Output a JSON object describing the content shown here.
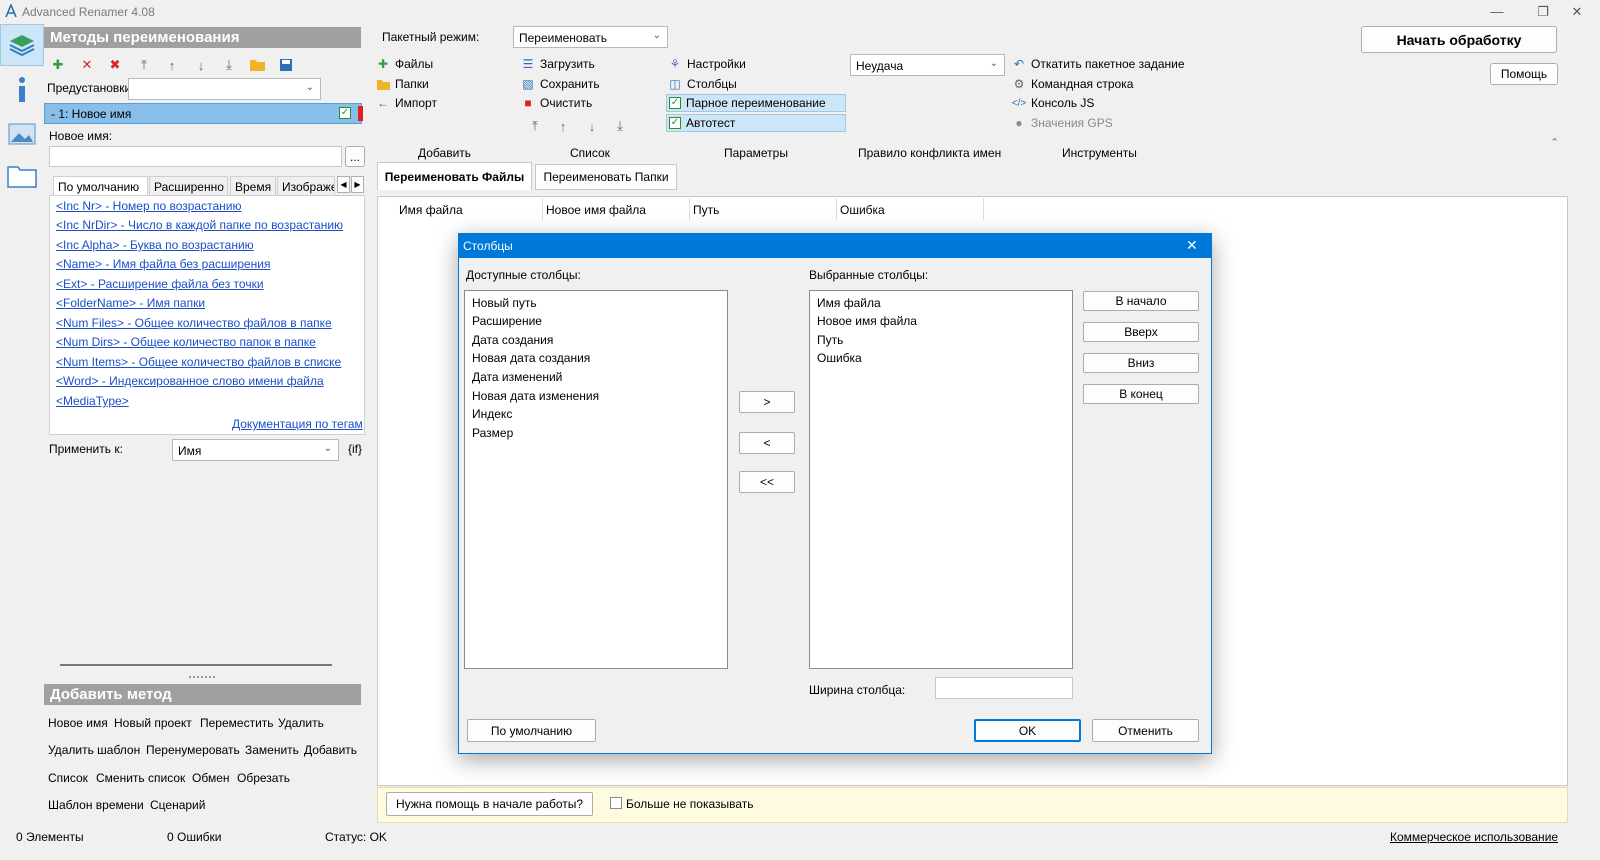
{
  "window": {
    "title": "Advanced Renamer 4.08",
    "minimize_icon": "minimize-icon",
    "restore_icon": "restore-icon",
    "close_icon": "close-icon"
  },
  "side_strip": {
    "items": [
      {
        "icon": "layers-icon",
        "active": true
      },
      {
        "icon": "info-icon",
        "active": false
      },
      {
        "icon": "image-icon",
        "active": false
      },
      {
        "icon": "folder-icon",
        "active": false
      }
    ]
  },
  "left_panel": {
    "title": "Методы переименования",
    "toolbar_icons": [
      "add-icon",
      "delete-icon",
      "clear-icon",
      "move-top-icon",
      "move-up-icon",
      "move-down-icon",
      "move-bottom-icon",
      "open-folder-icon",
      "save-icon"
    ],
    "presets_label": "Предустановки",
    "presets_value": "",
    "method_row_label": "-  1: Новое имя",
    "new_name_label": "Новое имя:",
    "new_name_value": "",
    "ellipsis_button": "...",
    "tabs": [
      "По умолчанию",
      "Расширенно",
      "Время",
      "Изображе"
    ],
    "tags": [
      "<Inc Nr> - Номер по возрастанию",
      "<Inc NrDir> - Число в каждой папке по возрастанию",
      "<Inc Alpha> - Буква по возрастанию",
      "<Name> - Имя файла без расширения",
      "<Ext> - Расширение файла без точки",
      "<FolderName> - Имя папки",
      "<Num Files> - Общее количество файлов в папке",
      "<Num Dirs> - Общее количество папок в папке",
      "<Num Items> - Общее количество файлов в списке",
      "<Word> - Индексированное слово имени файла",
      "<MediaType>"
    ],
    "docs_link": "Документация по тегам",
    "apply_to_label": "Применить к:",
    "apply_to_value": "Имя",
    "if_label": "{if}",
    "add_method_title": "Добавить метод",
    "methods": [
      [
        "Новое имя",
        "Новый проект",
        "Переместить",
        "Удалить"
      ],
      [
        "Удалить шаблон",
        "Перенумеровать",
        "Заменить",
        "Добавить"
      ],
      [
        "Список",
        "Сменить список",
        "Обмен",
        "Обрезать"
      ],
      [
        "Шаблон времени",
        "Сценарий"
      ]
    ]
  },
  "top": {
    "batch_mode_label": "Пакетный режим:",
    "batch_mode_value": "Переименовать",
    "add_items": [
      "Файлы",
      "Папки",
      "Импорт"
    ],
    "list_items": [
      "Загрузить",
      "Сохранить",
      "Очистить"
    ],
    "params_items": [
      "Настройки",
      "Столбцы",
      "Парное переименование",
      "Автотест"
    ],
    "conflict_value": "Неудача",
    "tools_items": [
      "Откатить пакетное задание",
      "Командная строка",
      "Консоль JS",
      "Значения GPS"
    ],
    "section_labels": [
      "Добавить",
      "Список",
      "Параметры",
      "Правило конфликта имен",
      "Инструменты"
    ],
    "start_button": "Начать обработку",
    "help_button": "Помощь",
    "collapse_icon": "chevron-up-icon"
  },
  "main": {
    "tabs": [
      "Переименовать Файлы",
      "Переименовать Папки"
    ],
    "columns": [
      "Имя файла",
      "Новое имя файла",
      "Путь",
      "Ошибка"
    ]
  },
  "dialog": {
    "title": "Столбцы",
    "available_label": "Доступные столбцы:",
    "available": [
      "Новый путь",
      "Расширение",
      "Дата создания",
      "Новая дата создания",
      "Дата изменений",
      "Новая дата изменения",
      "Индекс",
      "Размер"
    ],
    "selected_label": "Выбранные столбцы:",
    "selected": [
      "Имя файла",
      "Новое имя файла",
      "Путь",
      "Ошибка"
    ],
    "move_right": ">",
    "move_left": "<",
    "move_all_left": "<<",
    "order_buttons": [
      "В начало",
      "Вверх",
      "Вниз",
      "В конец"
    ],
    "width_label": "Ширина столбца:",
    "width_value": "",
    "default_button": "По умолчанию",
    "ok_button": "OK",
    "cancel_button": "Отменить"
  },
  "helpbar": {
    "button": "Нужна помощь в начале работы?",
    "checkbox_label": "Больше не показывать"
  },
  "status": {
    "elements": "0 Элементы",
    "errors": "0 Ошибки",
    "status": "Статус: OK",
    "commercial": "Коммерческое использование"
  }
}
